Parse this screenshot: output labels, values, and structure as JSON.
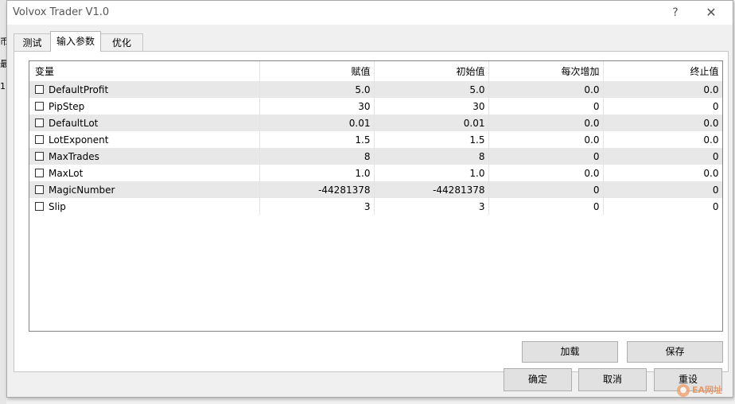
{
  "background_window": {
    "fragments": [
      "币",
      "最",
      "1"
    ]
  },
  "window": {
    "title": "Volvox Trader V1.0",
    "help_label": "?",
    "close_label": "✕"
  },
  "tabs": [
    {
      "label": "测试",
      "active": false
    },
    {
      "label": "输入参数",
      "active": true
    },
    {
      "label": "优化",
      "active": false
    }
  ],
  "table": {
    "headers": [
      "变量",
      "赋值",
      "初始值",
      "每次增加",
      "终止值"
    ],
    "rows": [
      {
        "name": "DefaultProfit",
        "checked": false,
        "value": "5.0",
        "start": "5.0",
        "step": "0.0",
        "stop": "0.0"
      },
      {
        "name": "PipStep",
        "checked": false,
        "value": "30",
        "start": "30",
        "step": "0",
        "stop": "0"
      },
      {
        "name": "DefaultLot",
        "checked": false,
        "value": "0.01",
        "start": "0.01",
        "step": "0.0",
        "stop": "0.0"
      },
      {
        "name": "LotExponent",
        "checked": false,
        "value": "1.5",
        "start": "1.5",
        "step": "0.0",
        "stop": "0.0"
      },
      {
        "name": "MaxTrades",
        "checked": false,
        "value": "8",
        "start": "8",
        "step": "0",
        "stop": "0"
      },
      {
        "name": "MaxLot",
        "checked": false,
        "value": "1.0",
        "start": "1.0",
        "step": "0.0",
        "stop": "0.0"
      },
      {
        "name": "MagicNumber",
        "checked": false,
        "value": "-44281378",
        "start": "-44281378",
        "step": "0",
        "stop": "0"
      },
      {
        "name": "Slip",
        "checked": false,
        "value": "3",
        "start": "3",
        "step": "0",
        "stop": "0"
      }
    ]
  },
  "panel_buttons": {
    "load": "加载",
    "save": "保存"
  },
  "dialog_buttons": {
    "ok": "确定",
    "cancel": "取消",
    "reset": "重设"
  },
  "watermark": {
    "text": "EA网址"
  }
}
